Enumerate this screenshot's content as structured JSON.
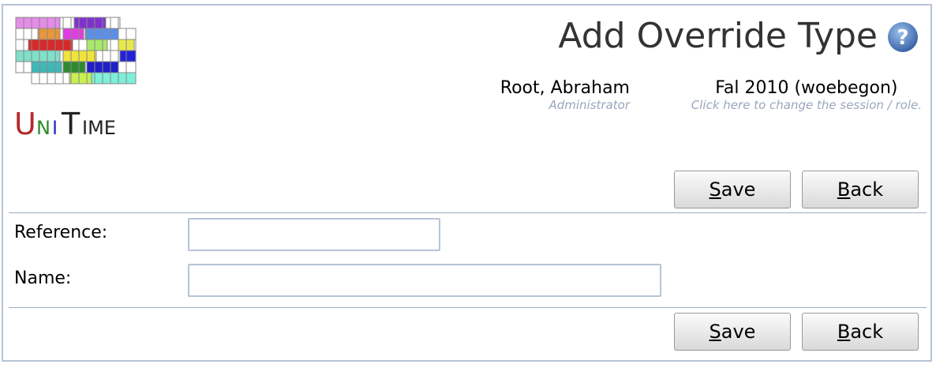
{
  "header": {
    "title": "Add Override Type",
    "logo_text": "UniTime",
    "help_icon": "question-icon"
  },
  "user": {
    "name": "Root, Abraham",
    "role": "Administrator"
  },
  "session": {
    "name": "Fal 2010 (woebegon)",
    "hint": "Click here to change the session / role."
  },
  "buttons": {
    "save_rest": "ave",
    "save_key": "S",
    "back_rest": "ack",
    "back_key": "B"
  },
  "form": {
    "reference_label": "Reference:",
    "reference_value": "",
    "name_label": "Name:",
    "name_value": ""
  },
  "colors": {
    "border": "#b9c3d6",
    "hint": "#9aa6bd",
    "help": "#4b77b5"
  }
}
